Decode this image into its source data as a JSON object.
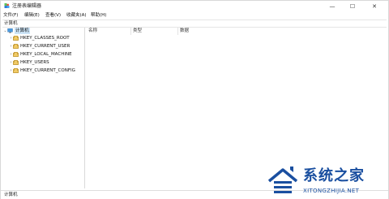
{
  "window": {
    "title": "注册表编辑器",
    "minimize_glyph": "—",
    "maximize_glyph": "☐",
    "close_glyph": "✕"
  },
  "menu": [
    "文件(F)",
    "编辑(E)",
    "查看(V)",
    "收藏夹(A)",
    "帮助(H)"
  ],
  "address": "计算机",
  "tree": {
    "root": {
      "label": "计算机",
      "icon": "computer-icon",
      "expander": "⌄"
    },
    "items": [
      {
        "label": "HKEY_CLASSES_ROOT",
        "icon": "folder-icon",
        "expander": "›"
      },
      {
        "label": "HKEY_CURRENT_USER",
        "icon": "folder-icon",
        "expander": "›"
      },
      {
        "label": "HKEY_LOCAL_MACHINE",
        "icon": "folder-icon",
        "expander": "›"
      },
      {
        "label": "HKEY_USERS",
        "icon": "folder-icon",
        "expander": "›"
      },
      {
        "label": "HKEY_CURRENT_CONFIG",
        "icon": "folder-icon",
        "expander": "›"
      }
    ]
  },
  "list": {
    "columns": [
      "名称",
      "类型",
      "数据"
    ]
  },
  "status": "计算机",
  "watermark": {
    "text": "系统之家",
    "url": "XITONGZHIJIA.NET",
    "color": "#1a4fa0"
  }
}
